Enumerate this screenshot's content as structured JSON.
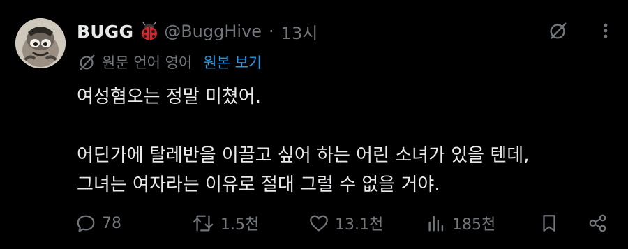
{
  "tweet": {
    "display_name": "BUGG",
    "handle": "@BuggHive",
    "separator": "·",
    "time": "13시",
    "translation": {
      "note": "원문 언어 영어",
      "show_original": "원본 보기"
    },
    "content_lines": [
      "여성혐오는 정말 미쳤어.",
      "어딘가에 탈레반을 이끌고 싶어 하는 어린 소녀가 있을 텐데,",
      "그녀는 여자라는 이유로 절대 그럴 수 없을 거야."
    ],
    "stats": {
      "replies": "78",
      "reposts": "1.5천",
      "likes": "13.1천",
      "views": "185천"
    }
  },
  "icons": {
    "avatar": "cartoon-bug-avatar",
    "name_badge": "ladybug-emoji",
    "grok": "grok-icon",
    "more": "more-vertical-icon",
    "translate": "translate-icon",
    "reply": "reply-icon",
    "repost": "repost-icon",
    "like": "heart-icon",
    "views": "views-icon",
    "bookmark": "bookmark-icon",
    "share": "share-icon"
  },
  "colors": {
    "background": "#000000",
    "text_primary": "#e7e9ea",
    "text_secondary": "#71767b",
    "accent": "#1d9bf0"
  }
}
